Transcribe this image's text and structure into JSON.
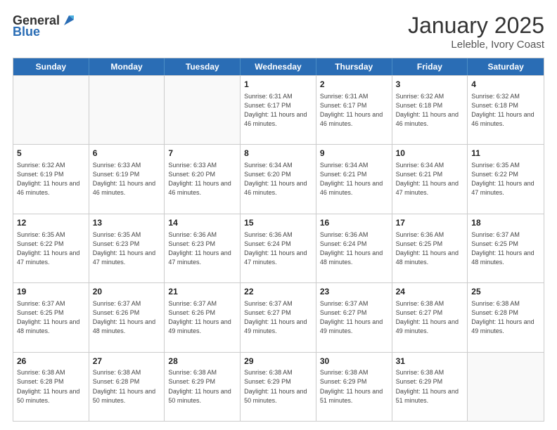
{
  "header": {
    "logo_general": "General",
    "logo_blue": "Blue",
    "month_title": "January 2025",
    "location": "Leleble, Ivory Coast"
  },
  "days_of_week": [
    "Sunday",
    "Monday",
    "Tuesday",
    "Wednesday",
    "Thursday",
    "Friday",
    "Saturday"
  ],
  "weeks": [
    [
      {
        "day": "",
        "empty": true
      },
      {
        "day": "",
        "empty": true
      },
      {
        "day": "",
        "empty": true
      },
      {
        "day": "1",
        "sunrise": "6:31 AM",
        "sunset": "6:17 PM",
        "daylight": "11 hours and 46 minutes."
      },
      {
        "day": "2",
        "sunrise": "6:31 AM",
        "sunset": "6:17 PM",
        "daylight": "11 hours and 46 minutes."
      },
      {
        "day": "3",
        "sunrise": "6:32 AM",
        "sunset": "6:18 PM",
        "daylight": "11 hours and 46 minutes."
      },
      {
        "day": "4",
        "sunrise": "6:32 AM",
        "sunset": "6:18 PM",
        "daylight": "11 hours and 46 minutes."
      }
    ],
    [
      {
        "day": "5",
        "sunrise": "6:32 AM",
        "sunset": "6:19 PM",
        "daylight": "11 hours and 46 minutes."
      },
      {
        "day": "6",
        "sunrise": "6:33 AM",
        "sunset": "6:19 PM",
        "daylight": "11 hours and 46 minutes."
      },
      {
        "day": "7",
        "sunrise": "6:33 AM",
        "sunset": "6:20 PM",
        "daylight": "11 hours and 46 minutes."
      },
      {
        "day": "8",
        "sunrise": "6:34 AM",
        "sunset": "6:20 PM",
        "daylight": "11 hours and 46 minutes."
      },
      {
        "day": "9",
        "sunrise": "6:34 AM",
        "sunset": "6:21 PM",
        "daylight": "11 hours and 46 minutes."
      },
      {
        "day": "10",
        "sunrise": "6:34 AM",
        "sunset": "6:21 PM",
        "daylight": "11 hours and 47 minutes."
      },
      {
        "day": "11",
        "sunrise": "6:35 AM",
        "sunset": "6:22 PM",
        "daylight": "11 hours and 47 minutes."
      }
    ],
    [
      {
        "day": "12",
        "sunrise": "6:35 AM",
        "sunset": "6:22 PM",
        "daylight": "11 hours and 47 minutes."
      },
      {
        "day": "13",
        "sunrise": "6:35 AM",
        "sunset": "6:23 PM",
        "daylight": "11 hours and 47 minutes."
      },
      {
        "day": "14",
        "sunrise": "6:36 AM",
        "sunset": "6:23 PM",
        "daylight": "11 hours and 47 minutes."
      },
      {
        "day": "15",
        "sunrise": "6:36 AM",
        "sunset": "6:24 PM",
        "daylight": "11 hours and 47 minutes."
      },
      {
        "day": "16",
        "sunrise": "6:36 AM",
        "sunset": "6:24 PM",
        "daylight": "11 hours and 48 minutes."
      },
      {
        "day": "17",
        "sunrise": "6:36 AM",
        "sunset": "6:25 PM",
        "daylight": "11 hours and 48 minutes."
      },
      {
        "day": "18",
        "sunrise": "6:37 AM",
        "sunset": "6:25 PM",
        "daylight": "11 hours and 48 minutes."
      }
    ],
    [
      {
        "day": "19",
        "sunrise": "6:37 AM",
        "sunset": "6:25 PM",
        "daylight": "11 hours and 48 minutes."
      },
      {
        "day": "20",
        "sunrise": "6:37 AM",
        "sunset": "6:26 PM",
        "daylight": "11 hours and 48 minutes."
      },
      {
        "day": "21",
        "sunrise": "6:37 AM",
        "sunset": "6:26 PM",
        "daylight": "11 hours and 49 minutes."
      },
      {
        "day": "22",
        "sunrise": "6:37 AM",
        "sunset": "6:27 PM",
        "daylight": "11 hours and 49 minutes."
      },
      {
        "day": "23",
        "sunrise": "6:37 AM",
        "sunset": "6:27 PM",
        "daylight": "11 hours and 49 minutes."
      },
      {
        "day": "24",
        "sunrise": "6:38 AM",
        "sunset": "6:27 PM",
        "daylight": "11 hours and 49 minutes."
      },
      {
        "day": "25",
        "sunrise": "6:38 AM",
        "sunset": "6:28 PM",
        "daylight": "11 hours and 49 minutes."
      }
    ],
    [
      {
        "day": "26",
        "sunrise": "6:38 AM",
        "sunset": "6:28 PM",
        "daylight": "11 hours and 50 minutes."
      },
      {
        "day": "27",
        "sunrise": "6:38 AM",
        "sunset": "6:28 PM",
        "daylight": "11 hours and 50 minutes."
      },
      {
        "day": "28",
        "sunrise": "6:38 AM",
        "sunset": "6:29 PM",
        "daylight": "11 hours and 50 minutes."
      },
      {
        "day": "29",
        "sunrise": "6:38 AM",
        "sunset": "6:29 PM",
        "daylight": "11 hours and 50 minutes."
      },
      {
        "day": "30",
        "sunrise": "6:38 AM",
        "sunset": "6:29 PM",
        "daylight": "11 hours and 51 minutes."
      },
      {
        "day": "31",
        "sunrise": "6:38 AM",
        "sunset": "6:29 PM",
        "daylight": "11 hours and 51 minutes."
      },
      {
        "day": "",
        "empty": true
      }
    ]
  ],
  "labels": {
    "sunrise_prefix": "Sunrise: ",
    "sunset_prefix": "Sunset: ",
    "daylight_prefix": "Daylight: "
  }
}
